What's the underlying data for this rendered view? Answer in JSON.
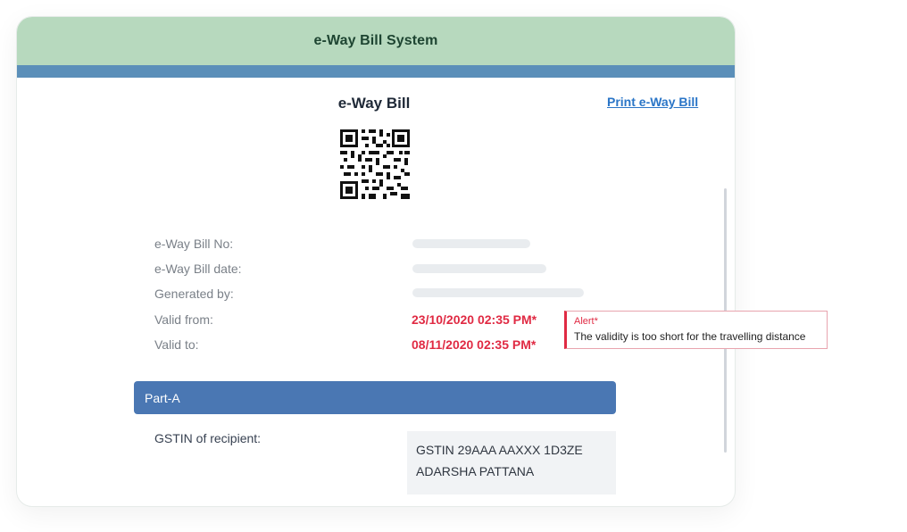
{
  "header": {
    "title": "e-Way Bill System"
  },
  "bill": {
    "title": "e-Way Bill",
    "print_link": "Print e-Way Bill",
    "qr_icon": "qr-code-icon"
  },
  "fields": {
    "bill_no_label": "e-Way Bill No:",
    "bill_date_label": "e-Way Bill date:",
    "generated_by_label": "Generated by:",
    "valid_from_label": "Valid from:",
    "valid_from_value": "23/10/2020 02:35 PM*",
    "valid_to_label": "Valid to:",
    "valid_to_value": "08/11/2020 02:35 PM*"
  },
  "alert": {
    "title": "Alert*",
    "message": "The validity is too short for the travelling distance"
  },
  "part_a": {
    "label": "Part-A",
    "gstin_label": "GSTIN of recipient:",
    "gstin_line1": "GSTIN 29AAA AAXXX 1D3ZE",
    "gstin_line2": "ADARSHA PATTANA"
  },
  "colors": {
    "header_bg": "#b7d9be",
    "header_strip": "#5b8fb9",
    "part_a_bg": "#4a77b3",
    "alert_red": "#e02a43",
    "link_blue": "#2a75c7"
  }
}
